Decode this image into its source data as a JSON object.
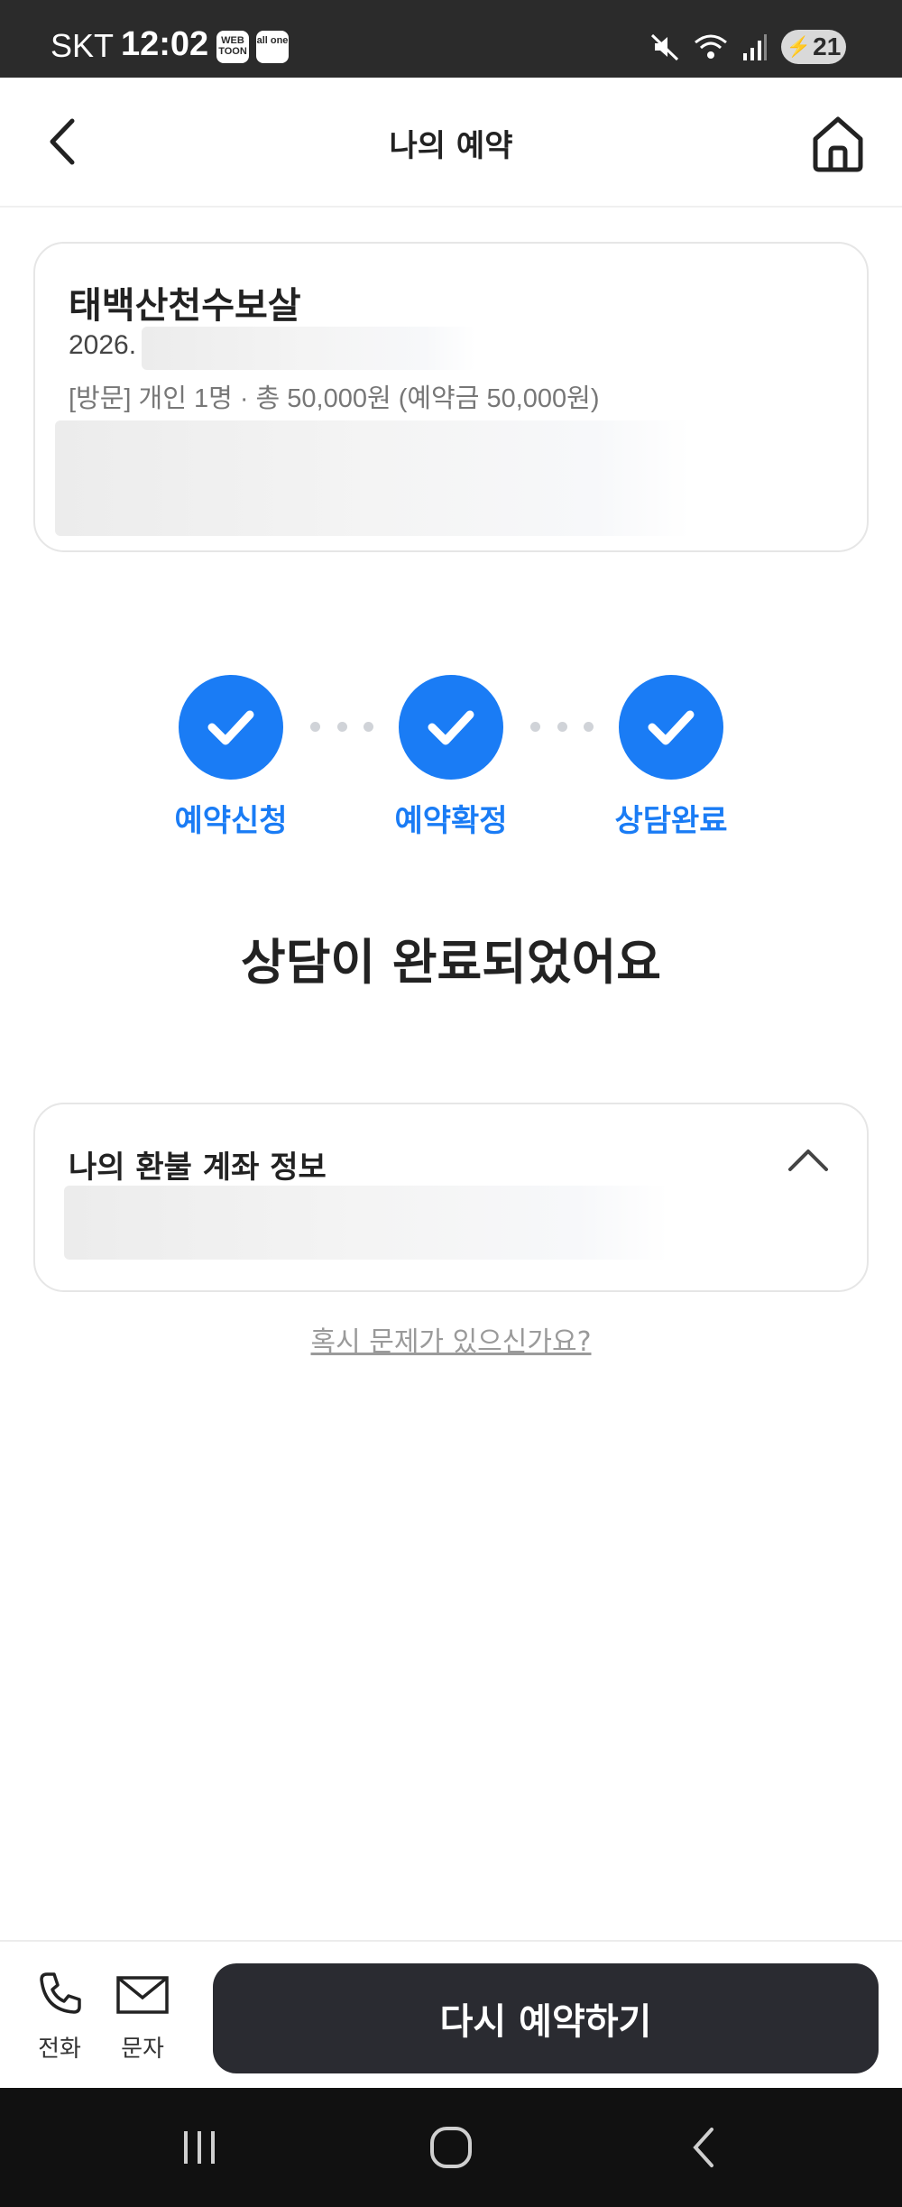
{
  "status_bar": {
    "carrier": "SKT",
    "time": "12:02",
    "app_icon_1": "WEB TOON",
    "app_icon_2": "all one",
    "battery": "21",
    "icons": [
      "mute-icon",
      "wifi-icon",
      "signal-icon",
      "battery-icon"
    ]
  },
  "header": {
    "title": "나의 예약",
    "back_icon": "chevron-left-icon",
    "home_icon": "home-icon"
  },
  "booking": {
    "shop_name": "태백산천수보살",
    "date": "2026.",
    "detail": "[방문] 개인 1명 · 총 50,000원 (예약금 50,000원)"
  },
  "steps": [
    {
      "label": "예약신청",
      "done": true
    },
    {
      "label": "예약확정",
      "done": true
    },
    {
      "label": "상담완료",
      "done": true
    }
  ],
  "status_message": "상담이 완료되었어요",
  "refund": {
    "title": "나의 환불 계좌 정보",
    "expanded": true
  },
  "help_link": "혹시 문제가 있으신가요?",
  "bottom": {
    "call_label": "전화",
    "sms_label": "문자",
    "rebook_label": "다시 예약하기"
  },
  "colors": {
    "accent": "#1a7cf5",
    "button_dark": "#2a2b31",
    "status_bar": "#2b2b2b"
  }
}
